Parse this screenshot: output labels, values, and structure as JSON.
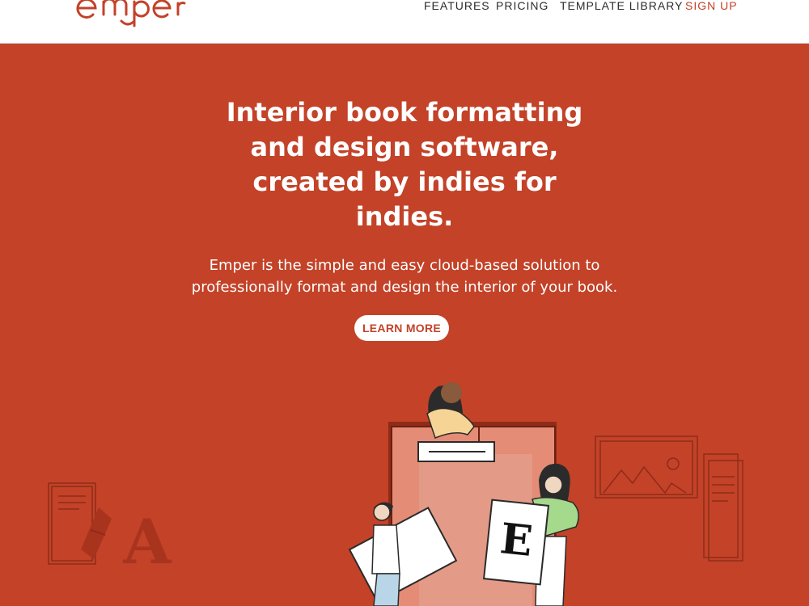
{
  "header": {
    "logo_text": "emper",
    "nav": [
      "FEATURES",
      "PRICING",
      "TEMPLATE LIBRARY",
      "SIGN UP"
    ]
  },
  "hero": {
    "title_lines": [
      "Interior book formatting",
      "and design software,",
      "created by indies for",
      "indies."
    ],
    "subtitle_lines": [
      "Emper is the simple and easy cloud-based solution to",
      "professionally format and design the interior of your book."
    ],
    "cta_label": "LEARN MORE"
  },
  "illustration": {
    "letters": [
      "A",
      "E"
    ]
  },
  "colors": {
    "brand": "#c34228",
    "header_bg": "#ffffff",
    "text_on_brand": "#ffffff",
    "nav_text": "#2b2b2b"
  },
  "icons": [
    "logo-icon",
    "book-cover-icon",
    "landscape-image-icon",
    "document-icon",
    "letter-a-icon",
    "letter-e-icon"
  ]
}
